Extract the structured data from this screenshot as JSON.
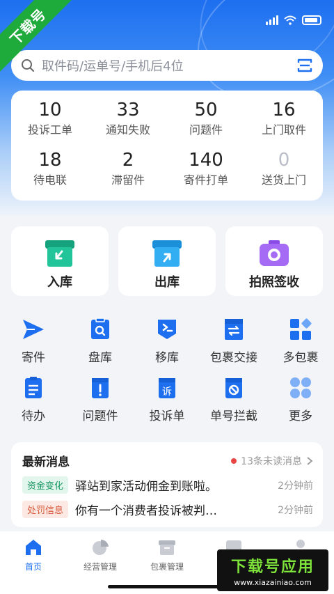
{
  "corner_badge": "下载号",
  "search": {
    "placeholder": "取件码/运单号/手机后4位"
  },
  "stats": [
    {
      "value": "10",
      "label": "投诉工单"
    },
    {
      "value": "33",
      "label": "通知失败"
    },
    {
      "value": "50",
      "label": "问题件"
    },
    {
      "value": "16",
      "label": "上门取件"
    },
    {
      "value": "18",
      "label": "待电联"
    },
    {
      "value": "2",
      "label": "滞留件"
    },
    {
      "value": "140",
      "label": "寄件打单"
    },
    {
      "value": "0",
      "label": "送货上门"
    }
  ],
  "big_actions": [
    {
      "label": "入库",
      "color": "#19b38a"
    },
    {
      "label": "出库",
      "color": "#27a3ea"
    },
    {
      "label": "拍照签收",
      "color": "#9a5cf0"
    }
  ],
  "grid": [
    {
      "label": "寄件",
      "icon": "send-icon"
    },
    {
      "label": "盘库",
      "icon": "inventory-icon"
    },
    {
      "label": "移库",
      "icon": "move-icon"
    },
    {
      "label": "包裹交接",
      "icon": "handover-icon"
    },
    {
      "label": "多包裹",
      "icon": "multi-package-icon"
    },
    {
      "label": "待办",
      "icon": "todo-icon"
    },
    {
      "label": "问题件",
      "icon": "problem-icon"
    },
    {
      "label": "投诉单",
      "icon": "complaint-icon"
    },
    {
      "label": "单号拦截",
      "icon": "intercept-icon"
    },
    {
      "label": "更多",
      "icon": "more-icon"
    }
  ],
  "news": {
    "title": "最新消息",
    "unread": "13条未读消息",
    "items": [
      {
        "tag": "资金变化",
        "text": "驿站到家活动佣金到账啦。",
        "time": "2分钟前"
      },
      {
        "tag": "处罚信息",
        "text": "你有一个消费者投诉被判…",
        "time": "2分钟前"
      }
    ]
  },
  "tabs": [
    {
      "label": "首页",
      "active": true
    },
    {
      "label": "经营管理"
    },
    {
      "label": "包裹管理"
    },
    {
      "label": ""
    },
    {
      "label": ""
    }
  ],
  "watermark": {
    "line1": "下载号应用",
    "line2": "www.xiazainiao.com"
  },
  "colors": {
    "primary": "#1e6ff0",
    "icon_blue": "#1e6ff0"
  }
}
